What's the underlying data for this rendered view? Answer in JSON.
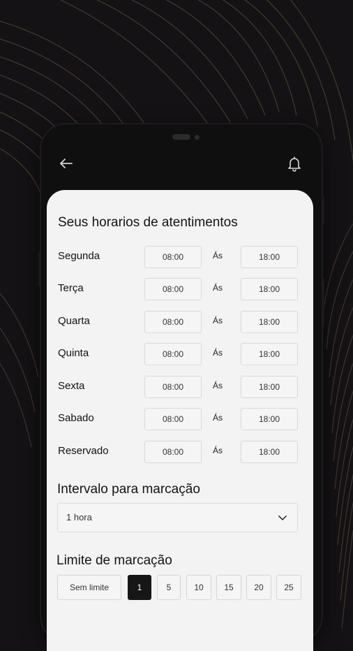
{
  "header": {
    "back_icon": "arrow-left-icon",
    "notification_icon": "bell-icon"
  },
  "schedule": {
    "title": "Seus horarios de atentimentos",
    "days": [
      {
        "label": "Segunda",
        "start": "08:00",
        "separator": "Ás",
        "end": "18:00"
      },
      {
        "label": "Terça",
        "start": "08:00",
        "separator": "Ás",
        "end": "18:00"
      },
      {
        "label": "Quarta",
        "start": "08:00",
        "separator": "Ás",
        "end": "18:00"
      },
      {
        "label": "Quinta",
        "start": "08:00",
        "separator": "Ás",
        "end": "18:00"
      },
      {
        "label": "Sexta",
        "start": "08:00",
        "separator": "Ás",
        "end": "18:00"
      },
      {
        "label": "Sabado",
        "start": "08:00",
        "separator": "Ás",
        "end": "18:00"
      },
      {
        "label": "Reservado",
        "start": "08:00",
        "separator": "Ás",
        "end": "18:00"
      }
    ]
  },
  "interval": {
    "title": "Intervalo para marcação",
    "selected": "1 hora"
  },
  "limit": {
    "title": "Limite de marcação",
    "options": [
      "Sem limite",
      "1",
      "5",
      "10",
      "15",
      "20",
      "25"
    ],
    "selected": "1"
  },
  "colors": {
    "accent": "#161616",
    "card_bg": "#f3f3f3",
    "wave_color": "#b48a60"
  }
}
